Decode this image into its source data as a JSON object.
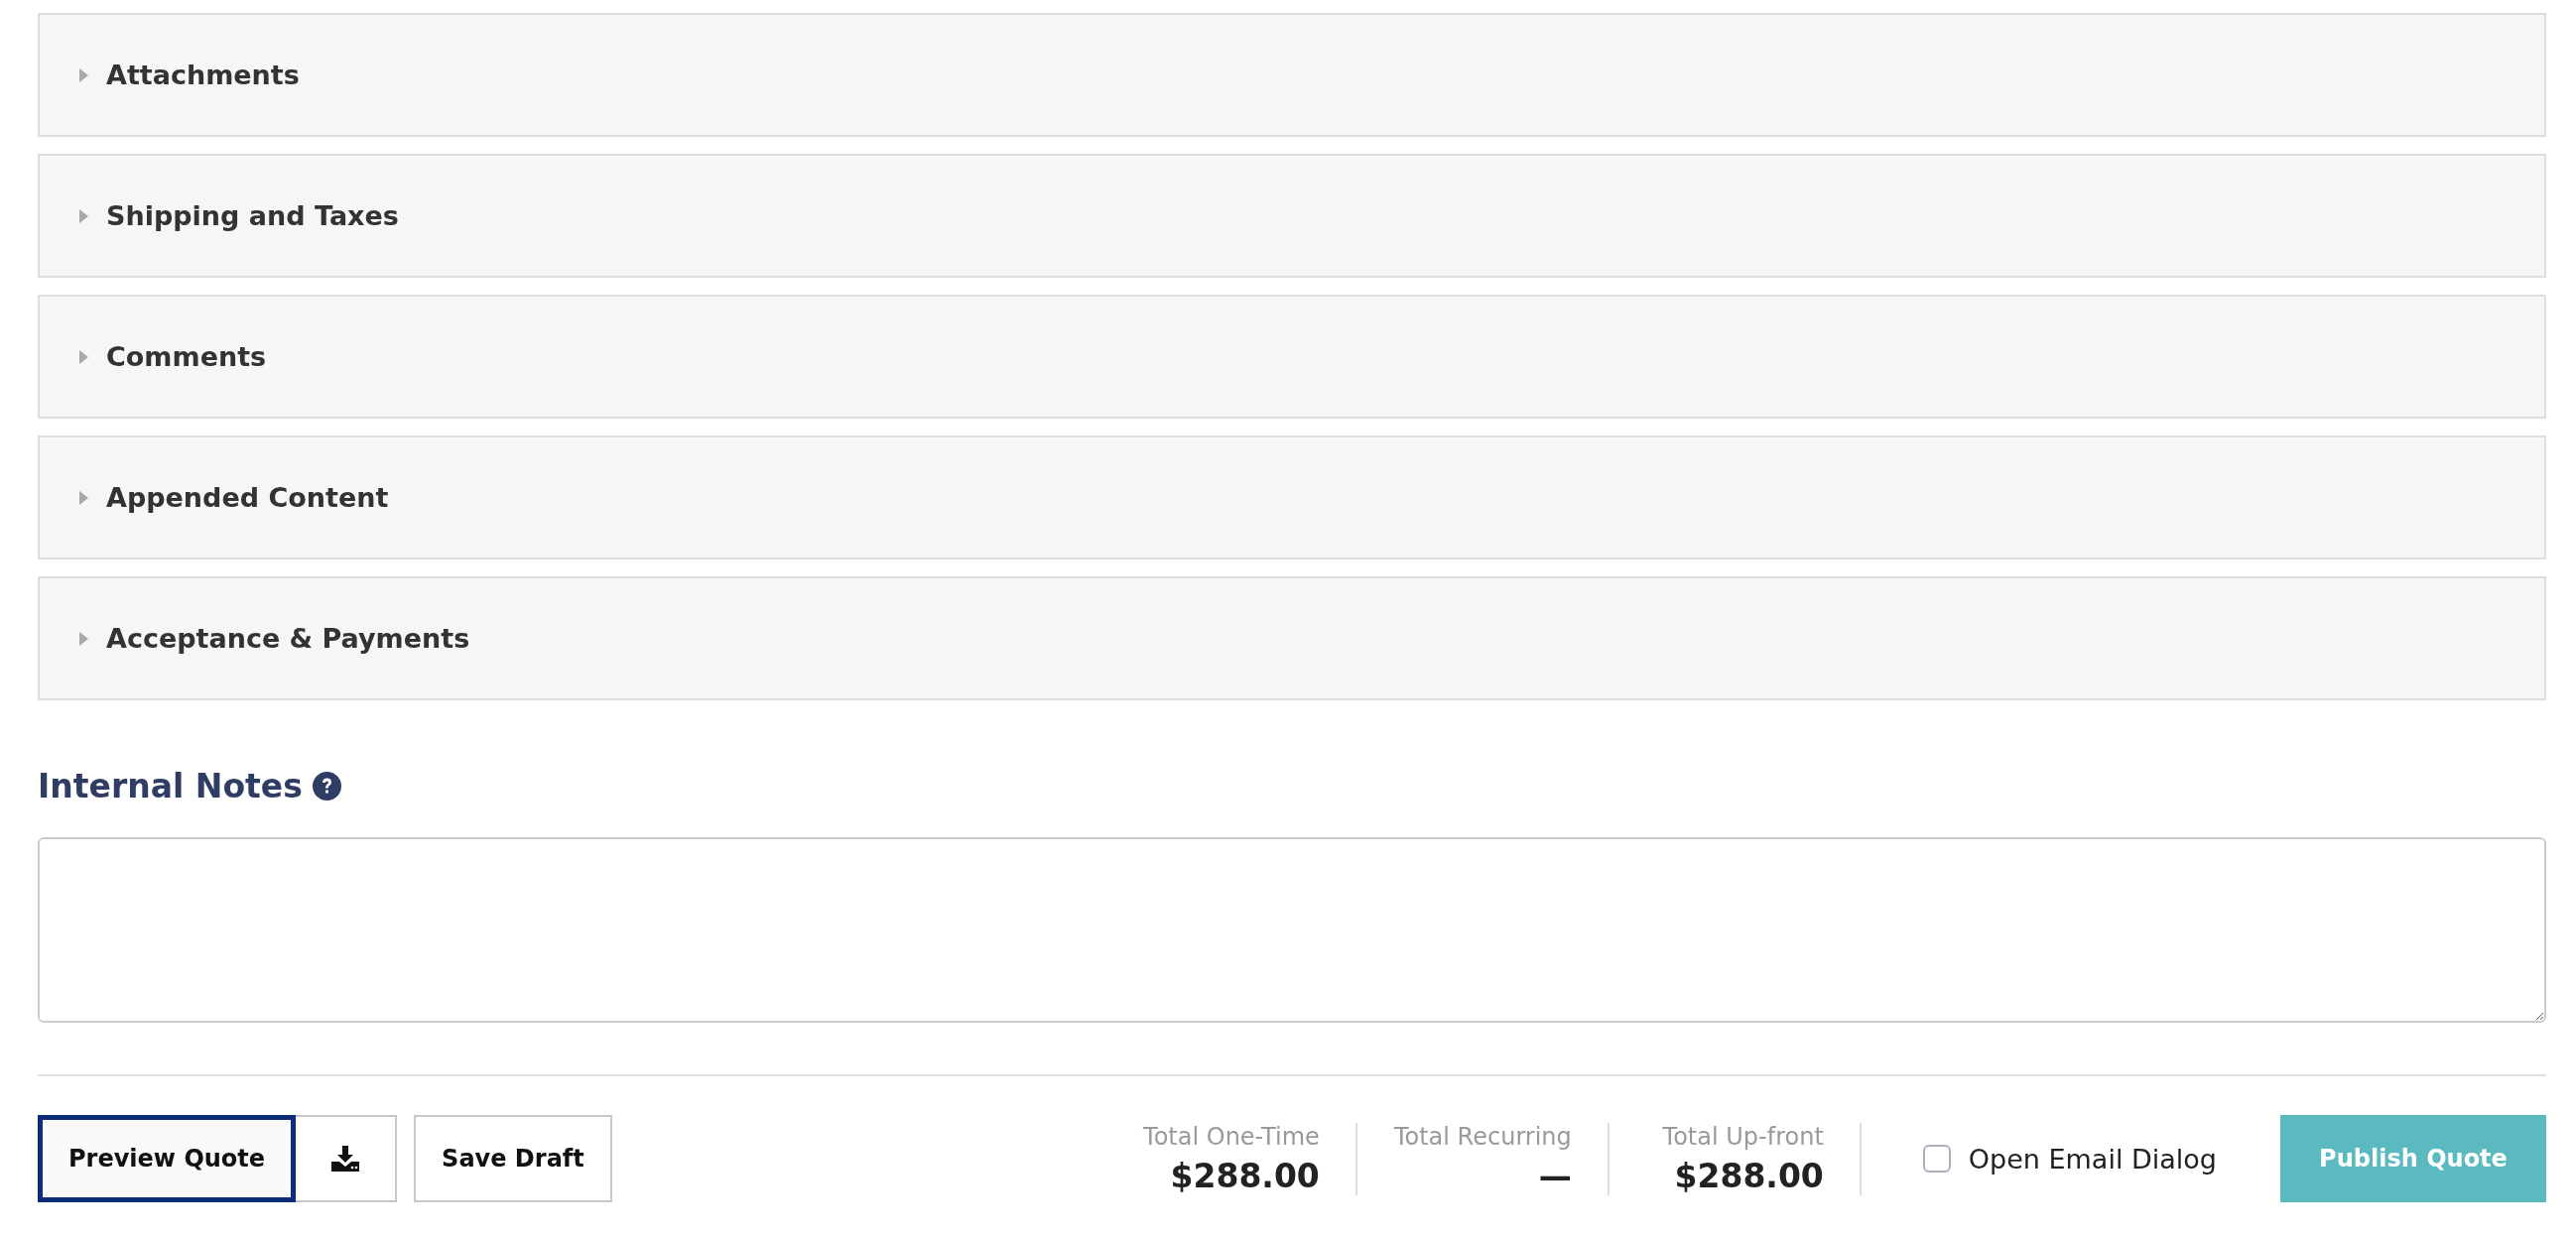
{
  "sections": [
    {
      "title": "Attachments",
      "expanded": false
    },
    {
      "title": "Shipping and Taxes",
      "expanded": false
    },
    {
      "title": "Comments",
      "expanded": false
    },
    {
      "title": "Appended Content",
      "expanded": false
    },
    {
      "title": "Acceptance & Payments",
      "expanded": false
    }
  ],
  "internal_notes": {
    "title": "Internal Notes"
  },
  "actions": {
    "preview": {
      "label": "Preview Quote",
      "focused": true
    },
    "save": {
      "label": "Save Draft"
    }
  },
  "totals": [
    {
      "label": "Total One-Time",
      "value": "$288.00"
    },
    {
      "label": "Total Recurring",
      "value": "—"
    },
    {
      "label": "Total Up-front",
      "value": "$288.00"
    }
  ],
  "email_dialog": {
    "label": "Open Email Dialog",
    "checked": false
  },
  "publish": {
    "label": "Publish Quote"
  }
}
